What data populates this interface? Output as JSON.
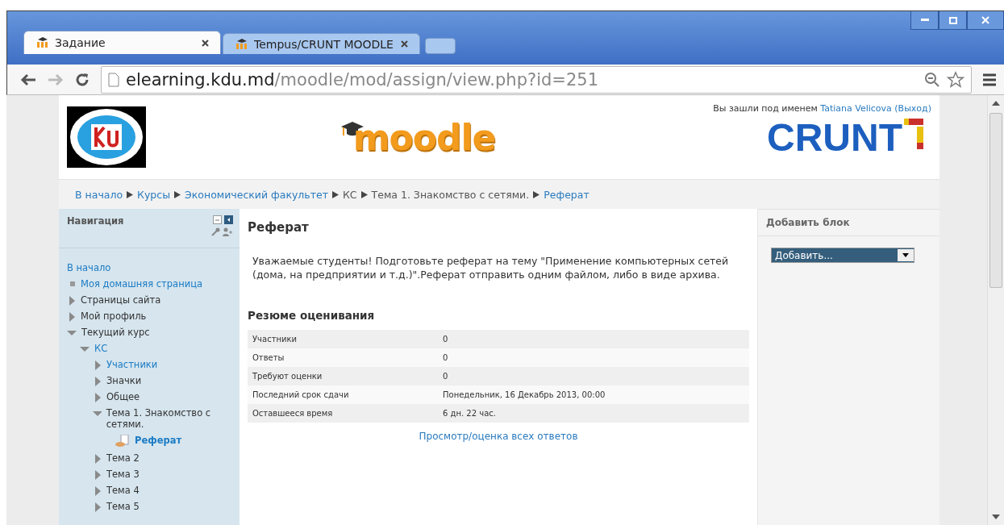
{
  "browser": {
    "tabs": [
      {
        "title": "Задание",
        "selected": true
      },
      {
        "title": "Tempus/CRUNT MOODLE",
        "selected": false
      }
    ],
    "url_host": "elearning.kdu.md",
    "url_path": "/moodle/mod/assign/view.php?id=251"
  },
  "header": {
    "login_prefix": "Вы зашли под именем",
    "user": "Tatiana Velicova",
    "logout": "(Выход)",
    "center_logo": "moodle",
    "right_logo": "CRUNT"
  },
  "breadcrumbs": [
    "В начало",
    "Курсы",
    "Экономический факультет",
    "КС",
    "Тема 1. Знакомство с сетями.",
    "Реферат"
  ],
  "navigation": {
    "title": "Навигация",
    "items": [
      {
        "label": "В начало",
        "kind": "root",
        "link": true
      },
      {
        "label": "Моя домашняя страница",
        "kind": "leaf",
        "link": true
      },
      {
        "label": "Страницы сайта",
        "kind": "branch",
        "expanded": false,
        "link": false
      },
      {
        "label": "Мой профиль",
        "kind": "branch",
        "expanded": false,
        "link": false
      },
      {
        "label": "Текущий курс",
        "kind": "branch",
        "expanded": true,
        "link": false,
        "children": [
          {
            "label": "КС",
            "kind": "branch",
            "expanded": true,
            "link": true,
            "children": [
              {
                "label": "Участники",
                "kind": "branch",
                "expanded": false,
                "link": true
              },
              {
                "label": "Значки",
                "kind": "branch",
                "expanded": false,
                "link": false
              },
              {
                "label": "Общее",
                "kind": "branch",
                "expanded": false,
                "link": false
              },
              {
                "label": "Тема 1. Знакомство с сетями.",
                "kind": "branch",
                "expanded": true,
                "link": false,
                "children": [
                  {
                    "label": "Реферат",
                    "kind": "activity",
                    "link": true
                  }
                ]
              },
              {
                "label": "Тема 2",
                "kind": "branch",
                "expanded": false,
                "link": false
              },
              {
                "label": "Тема 3",
                "kind": "branch",
                "expanded": false,
                "link": false
              },
              {
                "label": "Тема 4",
                "kind": "branch",
                "expanded": false,
                "link": false
              },
              {
                "label": "Тема 5",
                "kind": "branch",
                "expanded": false,
                "link": false
              }
            ]
          }
        ]
      }
    ]
  },
  "main": {
    "title": "Реферат",
    "intro": "Уважаемые студенты! Подготовьте реферат на тему \"Применение компьютерных сетей (дома, на предприятии и т.д.)\".Реферат отправить одним файлом, либо в виде архива.",
    "summary_title": "Резюме оценивания",
    "summary": [
      {
        "label": "Участники",
        "value": "0"
      },
      {
        "label": "Ответы",
        "value": "0"
      },
      {
        "label": "Требуют оценки",
        "value": "0"
      },
      {
        "label": "Последний срок сдачи",
        "value": "Понедельник, 16 Декабрь 2013, 00:00"
      },
      {
        "label": "Оставшееся время",
        "value": "6 дн. 22 час."
      }
    ],
    "view_all_link": "Просмотр/оценка всех ответов"
  },
  "add_block": {
    "title": "Добавить блок",
    "select_value": "Добавить..."
  }
}
